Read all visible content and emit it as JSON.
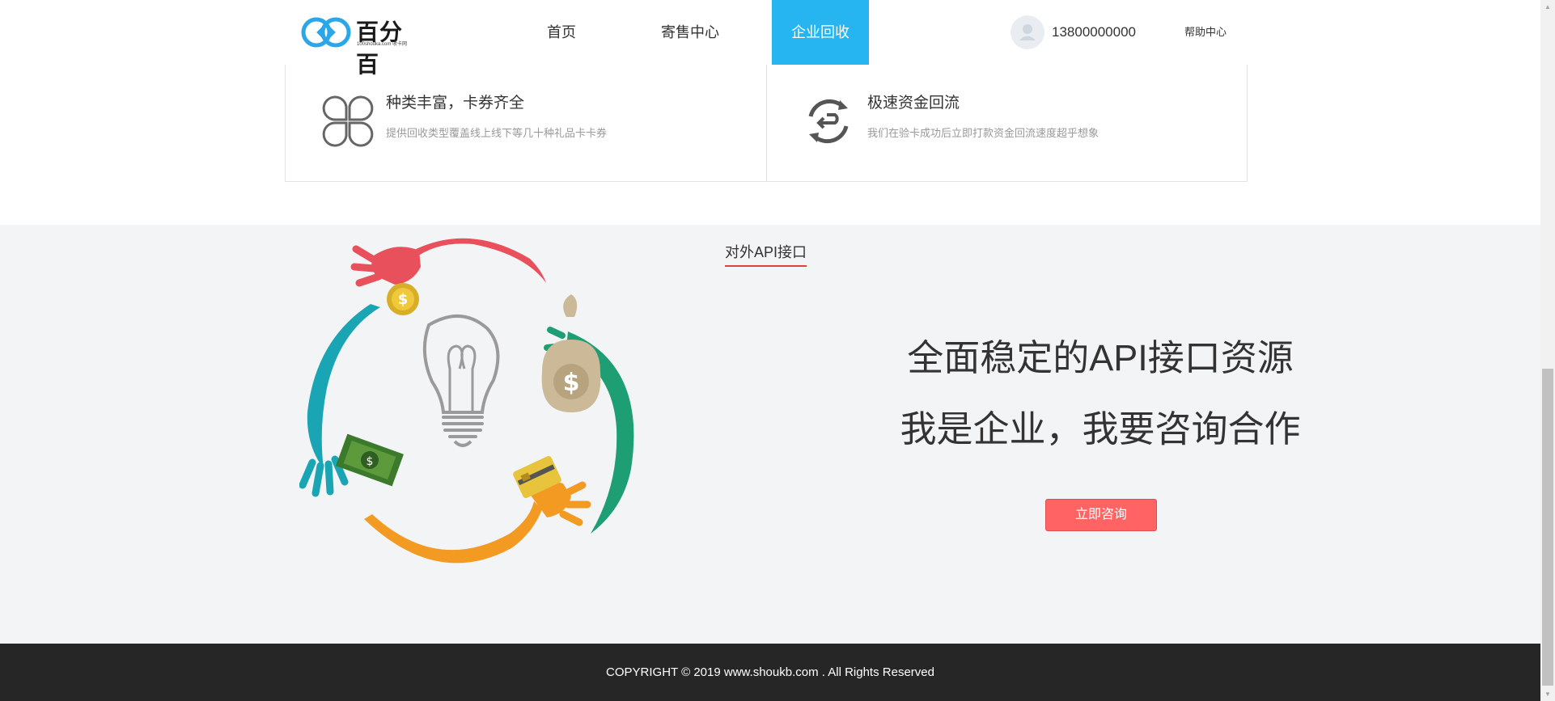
{
  "header": {
    "logo": {
      "name": "百分百",
      "sub": "100shouka.com 收卡网",
      "icon": "infinity-loop-logo"
    },
    "nav": [
      {
        "label": "首页",
        "active": false
      },
      {
        "label": "寄售中心",
        "active": false
      },
      {
        "label": "企业回收",
        "active": true
      }
    ],
    "user": {
      "phone": "13800000000",
      "icon": "user-avatar-icon"
    },
    "help": "帮助中心"
  },
  "features": [
    {
      "icon": "clover-icon",
      "title": "种类丰富，卡券齐全",
      "desc": "提供回收类型覆盖线上线下等几十种礼品卡卡券"
    },
    {
      "icon": "cycle-return-icon",
      "title": "极速资金回流",
      "desc": "我们在验卡成功后立即打款资金回流速度超乎想象"
    }
  ],
  "api": {
    "tab": "对外API接口",
    "headline1": "全面稳定的API接口资源",
    "headline2": "我是企业，我要咨询合作",
    "button": "立即咨询",
    "illustration": "hands-exchange-money-illustration"
  },
  "footer": {
    "copyright": "COPYRIGHT © 2019 www.shoukb.com . All Rights Reserved"
  },
  "colors": {
    "accent": "#27b5f1",
    "button": "#ff6363",
    "tab_underline": "#d9453c",
    "footer": "#262626"
  }
}
